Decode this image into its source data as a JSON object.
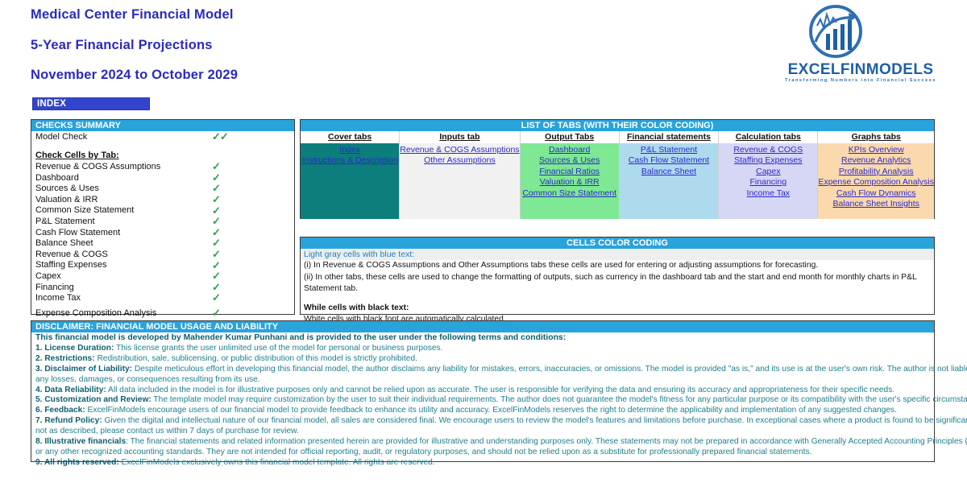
{
  "header": {
    "title_lines": [
      "Medical Center Financial Model",
      "5-Year Financial Projections",
      "November 2024 to October 2029"
    ],
    "index_button": "INDEX",
    "accent_blue": "#2a2ac0",
    "index_bg": "#3344cc"
  },
  "logo": {
    "wordmark": "EXCELFINMODELS",
    "tagline": "Transforming Numbers into Financial Success",
    "color": "#1f5fa8"
  },
  "checks": {
    "header": "CHECKS  SUMMARY",
    "header_bg": "#29a3dc",
    "check_color": "#2f9e4f",
    "model_check": {
      "label": "Model Check",
      "mark": "✓✓"
    },
    "section_label": "Check Cells by Tab:",
    "items": [
      {
        "label": "Revenue & COGS Assumptions",
        "mark": "✓"
      },
      {
        "label": "Dashboard",
        "mark": "✓"
      },
      {
        "label": "Sources & Uses",
        "mark": "✓"
      },
      {
        "label": "Valuation & IRR",
        "mark": "✓"
      },
      {
        "label": "Common Size Statement",
        "mark": "✓"
      },
      {
        "label": "P&L Statement",
        "mark": "✓"
      },
      {
        "label": "Cash Flow Statement",
        "mark": "✓"
      },
      {
        "label": "Balance Sheet",
        "mark": "✓"
      },
      {
        "label": "Revenue & COGS",
        "mark": "✓"
      },
      {
        "label": "Staffing Expenses",
        "mark": "✓"
      },
      {
        "label": "Capex",
        "mark": "✓"
      },
      {
        "label": "Financing",
        "mark": "✓"
      },
      {
        "label": "Income Tax",
        "mark": "✓"
      }
    ],
    "last_item": {
      "label": "Expense Composition Analysis",
      "mark": "✓"
    }
  },
  "tabs_table": {
    "header": "LIST OF TABS (WITH THEIR COLOR CODING)",
    "columns": [
      {
        "head": "Cover tabs",
        "color": "#0c7e7c",
        "links": [
          "Index",
          "Instructions & Description"
        ]
      },
      {
        "head": "Inputs tab",
        "color": "#f1f1f1",
        "links": [
          "Revenue & COGS Assumptions",
          "Other Assumptions"
        ]
      },
      {
        "head": "Output Tabs",
        "color": "#7ee894",
        "links": [
          "Dashboard",
          "Sources & Uses",
          "Financial Ratios ",
          "Valuation & IRR",
          "Common Size Statement"
        ]
      },
      {
        "head": "Financial statements tabs",
        "color": "#aedaee",
        "links": [
          "P&L Statement",
          "Cash Flow Statement",
          "Balance Sheet"
        ]
      },
      {
        "head": "Calculation tabs",
        "color": "#d6d6f5",
        "links": [
          "Revenue & COGS",
          "Staffing Expenses",
          "Capex ",
          "Financing",
          "Income Tax"
        ]
      },
      {
        "head": "Graphs tabs",
        "color": "#fbd9ae",
        "links": [
          "KPIs Overview",
          "Revenue Analytics",
          "Profitability Analysis",
          "Expense Composition Analysis",
          "Cash Flow Dynamics",
          "Balance Sheet Insights"
        ]
      }
    ]
  },
  "color_coding": {
    "header": "CELLS COLOR CODING",
    "gray_heading": "Light gray cells with blue text:",
    "line_i": "(i) In Revenue & COGS Assumptions and Other Assumptions tabs these cells are used for entering or adjusting assumptions for forecasting.",
    "line_ii": "(ii) In other tabs, these cells are used to change the formatting of outputs, such as currency in the dashboard tab and the start and end month for monthly charts in P&L Statement tab.",
    "white_heading": "While cells with black text:",
    "white_line": "White cells with black font are automatically calculated."
  },
  "disclaimer": {
    "header": "DISCLAIMER: FINANCIAL MODEL USAGE AND LIABILITY",
    "intro": "This financial model  is developed by Mahender Kumar Punhani and is provided to the user under the following terms and conditions:",
    "lines": [
      {
        "num": "1. ",
        "term": "License Duration:",
        "text": " This license grants the user unlimited use of the model for personal or business purposes."
      },
      {
        "num": "2. ",
        "term": "Restrictions:",
        "text": " Redistribution, sale, sublicensing, or public distribution of this model is strictly prohibited."
      },
      {
        "num": "3. ",
        "term": "Disclaimer of Liability:",
        "text": " Despite meticulous effort in developing this financial model, the author disclaims any liability for mistakes, errors, inaccuracies, or omissions. The model is provided \"as is,\" and its use is at the user's own risk. The author is  not liable for"
      },
      {
        "num": "",
        "term": "",
        "text": "any  losses, damages, or consequences resulting from its use."
      },
      {
        "num": "4. ",
        "term": "Data Reliability:",
        "text": " All data included in the model is for illustrative purposes only and cannot be relied upon as accurate. The user is  responsible for verifying the data and ensuring its accuracy and appropriateness for their specific needs."
      },
      {
        "num": "5. ",
        "term": "Customization and Review:",
        "text": " The template model may require customization by the user to suit their individual requirements. The author does not guarantee the model's fitness for any  particular purpose or its compatibility with the user's specific circumstances."
      },
      {
        "num": "6. ",
        "term": "Feedback:",
        "text": " ExcelFinModels encourage users of our financial model to provide feedback to enhance its utility and accuracy. ExcelFinModels reserves the right to determine the applicability and implementation of any suggested changes."
      },
      {
        "num": "7. ",
        "term": "Refund Policy:",
        "text": " Given the digital and intellectual nature of our financial model, all sales are considered final. We encourage users to review the model's features and limitations before purchase. In exceptional cases where a product is found to be  significantly"
      },
      {
        "num": "",
        "term": "",
        "text": "not as described, please contact us within 7 days of purchase for review."
      },
      {
        "num": "8. ",
        "term": "Illustrative financials",
        "text": ": The financial statements and related information presented herein are provided for illustrative and understanding purposes only. These statements may not be prepared in accordance with Generally Accepted Accounting Principles (GAAP)"
      },
      {
        "num": "",
        "term": "",
        "text": "or any other  recognized accounting standards. They are not intended for official reporting, audit, or regulatory purposes, and should not be relied upon as a substitute for professionally prepared financial statements."
      },
      {
        "num": "9. ",
        "term": "All rights reserved:",
        "text": " ExcelFinModels exclusively owns this financial model template. All rights are reserved."
      }
    ]
  }
}
